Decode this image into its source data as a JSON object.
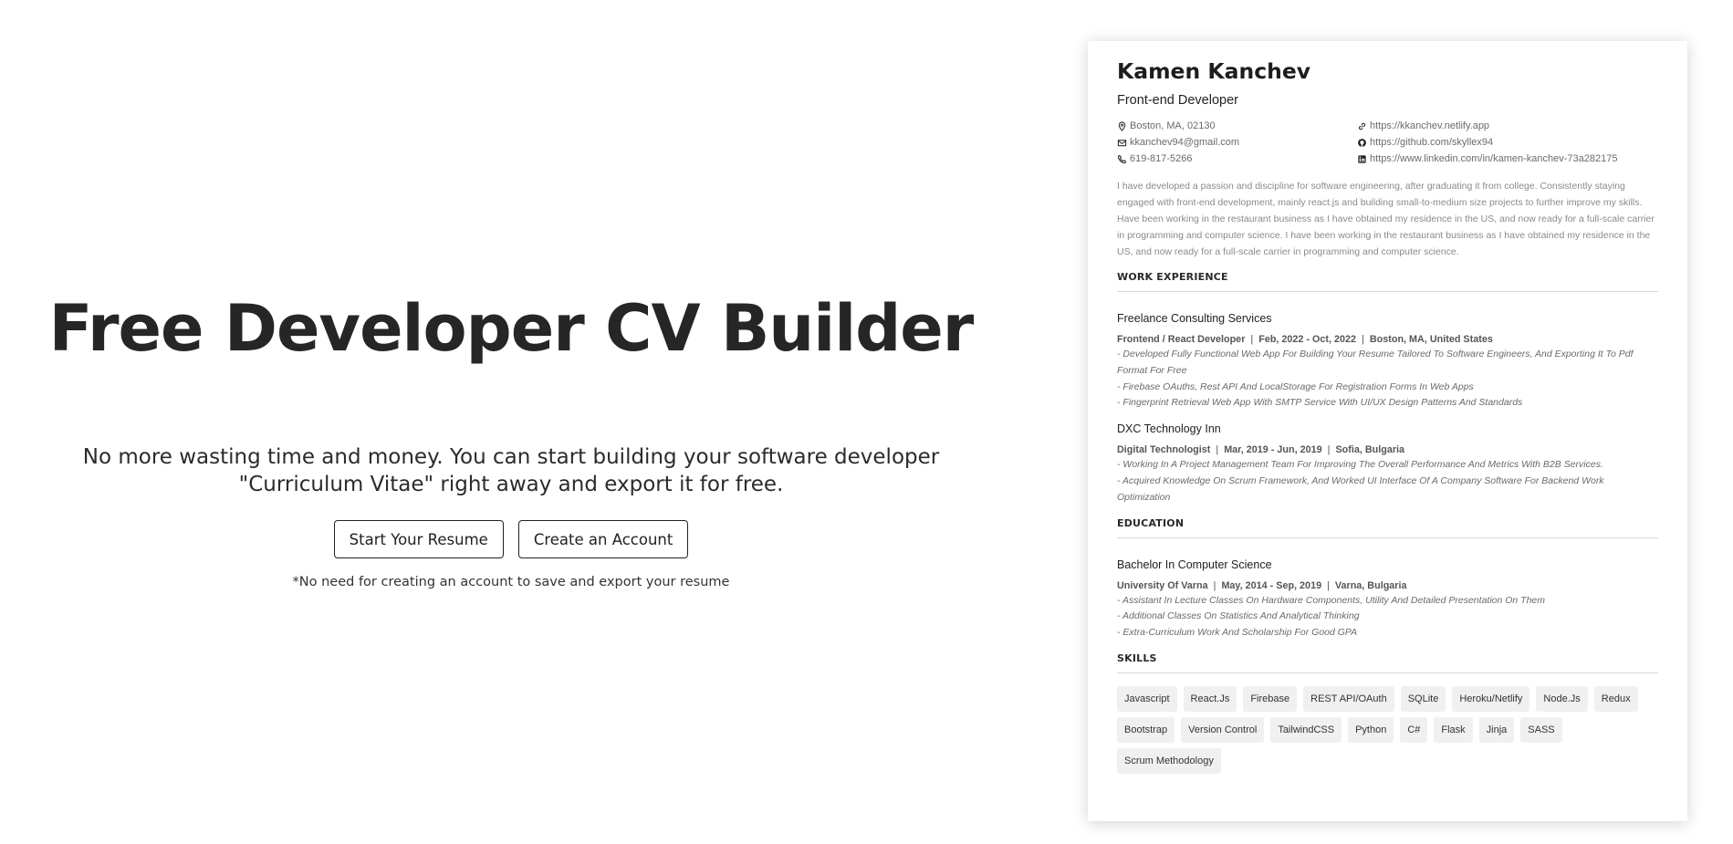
{
  "hero": {
    "title": "Free Developer CV Builder",
    "subtitle": "No more wasting time and money. You can start building your software developer \"Curriculum Vitae\" right away and export it for free.",
    "start_button": "Start Your Resume",
    "account_button": "Create an Account",
    "note": "*No need for creating an account to save and export your resume"
  },
  "cv": {
    "name": "Kamen Kanchev",
    "role": "Front-end Developer",
    "contacts": [
      {
        "icon": "location-icon",
        "text": "Boston, MA, 02130"
      },
      {
        "icon": "link-icon",
        "text": "https://kkanchev.netlify.app"
      },
      {
        "icon": "mail-icon",
        "text": "kkanchev94@gmail.com"
      },
      {
        "icon": "github-icon",
        "text": "https://github.com/skyllex94"
      },
      {
        "icon": "phone-icon",
        "text": "619-817-5266"
      },
      {
        "icon": "linkedin-icon",
        "text": "https://www.linkedin.com/in/kamen-kanchev-73a282175"
      }
    ],
    "summary": "I have developed a passion and discipline for software engineering, after graduating it from college. Consistently staying engaged with front-end development, mainly react.js and building small-to-medium size projects to further improve my skills. Have been working in the restaurant business as I have obtained my residence in the US, and now ready for a full-scale carrier in programming and computer science. I have been working in the restaurant business as I have obtained my residence in the US, and now ready for a full-scale carrier in programming and computer science.",
    "work_title": "WORK EXPERIENCE",
    "jobs": [
      {
        "company": "Freelance Consulting Services",
        "position": "Frontend / React Developer",
        "dates": "Feb, 2022 - Oct, 2022",
        "location": "Boston, MA, United States",
        "bullets": [
          "- Developed Fully Functional Web App For Building Your Resume Tailored To Software Engineers, And Exporting It To Pdf Format For Free",
          "- Firebase OAuths, Rest API And LocalStorage For Registration Forms In Web Apps",
          "- Fingerprint Retrieval Web App With SMTP Service With UI/UX Design Patterns And Standards"
        ]
      },
      {
        "company": "DXC Technology Inn",
        "position": "Digital Technologist",
        "dates": "Mar, 2019 - Jun, 2019",
        "location": "Sofia, Bulgaria",
        "bullets": [
          "- Working In A Project Management Team For Improving The Overall Performance And Metrics With B2B Services.",
          "- Acquired Knowledge On Scrum Framework, And Worked UI Interface Of A Company Software For Backend Work Optimization"
        ]
      }
    ],
    "education_title": "EDUCATION",
    "education": {
      "degree": "Bachelor In Computer Science",
      "school": "University Of Varna",
      "dates": "May, 2014 - Sep, 2019",
      "location": "Varna, Bulgaria",
      "bullets": [
        "- Assistant In Lecture Classes On Hardware Components, Utility And Detailed Presentation On Them",
        "- Additional Classes On Statistics And Analytical Thinking",
        "- Extra-Curriculum Work And Scholarship For Good GPA"
      ]
    },
    "skills_title": "SKILLS",
    "skills": [
      "Javascript",
      "React.Js",
      "Firebase",
      "REST API/OAuth",
      "SQLite",
      "Heroku/Netlify",
      "Node.Js",
      "Redux",
      "Bootstrap",
      "Version Control",
      "TailwindCSS",
      "Python",
      "C#",
      "Flask",
      "Jinja",
      "SASS",
      "Scrum Methodology"
    ]
  }
}
